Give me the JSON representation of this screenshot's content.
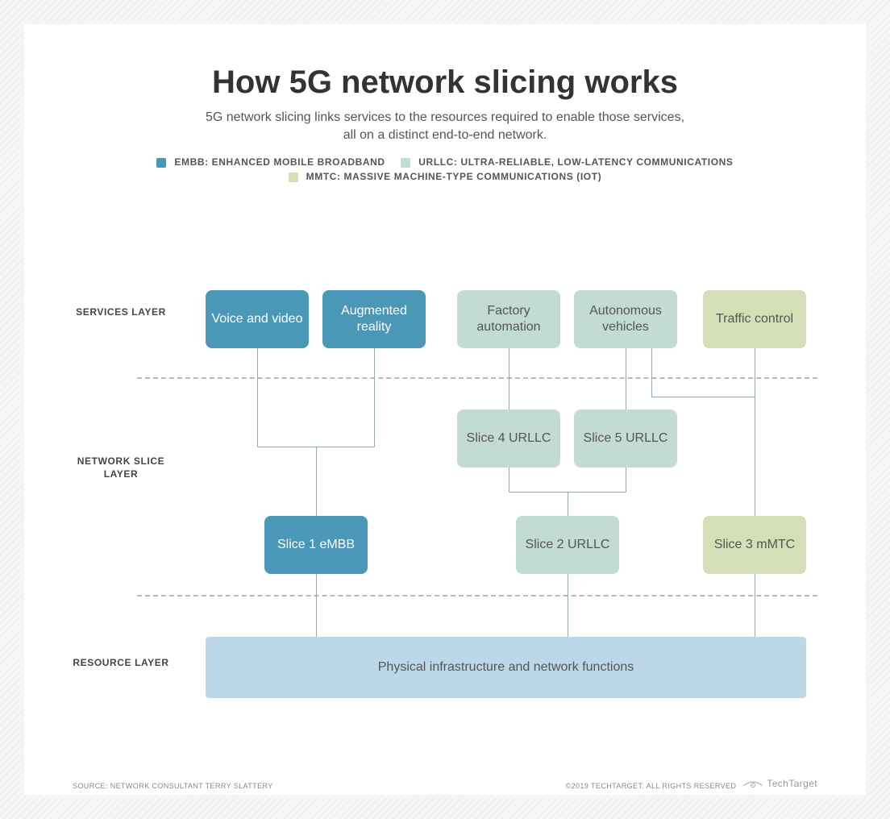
{
  "title": "How 5G network slicing works",
  "subtitle_l1": "5G network slicing links services to the resources required to enable those services,",
  "subtitle_l2": "all on a distinct end-to-end network.",
  "legend": {
    "embb": "eMBB: enhanced mobile broadband",
    "urllc": "URLLC: ultra-reliable, low-latency communications",
    "mmtc": "mMTC: massive machine-type communications (IoT)"
  },
  "layers": {
    "services": "SERVICES LAYER",
    "slice": "NETWORK SLICE LAYER",
    "resource": "RESOURCE LAYER"
  },
  "services": {
    "voice": "Voice and video",
    "ar": "Augmented reality",
    "factory": "Factory automation",
    "auto": "Autonomous vehicles",
    "traffic": "Traffic control"
  },
  "slices": {
    "s4": "Slice 4 URLLC",
    "s5": "Slice 5 URLLC",
    "s1": "Slice 1 eMBB",
    "s2": "Slice 2 URLLC",
    "s3": "Slice 3 mMTC"
  },
  "resource_box": "Physical infrastructure and network functions",
  "source": "SOURCE: NETWORK CONSULTANT TERRY SLATTERY",
  "copyright": "©2019 TECHTARGET. ALL RIGHTS RESERVED",
  "brand": "TechTarget"
}
